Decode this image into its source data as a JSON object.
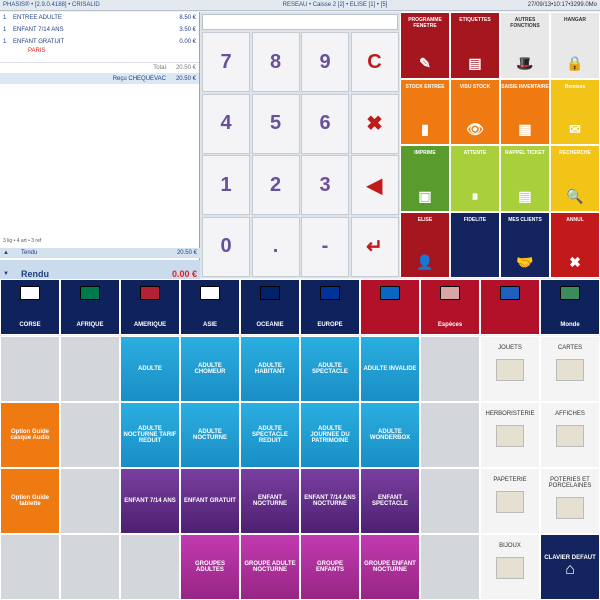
{
  "topbar": {
    "left": "PHASIS® • [2.9.0.4188] • CRISALID",
    "center": "RESEAU  •  Caisse 2 [2] • ELISE [1]  •  [5]",
    "right": "27/09/13•10:17•3299.0Mo"
  },
  "ticket": {
    "lines": [
      {
        "q": "1",
        "n": "ENTREE ADULTE",
        "p": "8.50 €"
      },
      {
        "q": "1",
        "n": "ENFANT 7/14 ANS",
        "p": "3.50 €"
      },
      {
        "q": "1",
        "n": "ENFANT GRATUIT",
        "p": "0.00 €"
      }
    ],
    "sub": "PARIS",
    "total_label": "Total",
    "total": "20.50 €",
    "recu_label": "Reçu CHEQUEVAC",
    "recu": "20.50 €",
    "stats": "3 lig • 4 art • 3 ref",
    "tendu_label": "Tendu",
    "tendu": "20.50 €",
    "rendu_label": "Rendu",
    "rendu": "0.00 €"
  },
  "keypad": [
    "7",
    "8",
    "9",
    "C",
    "4",
    "5",
    "6",
    "✖",
    "1",
    "2",
    "3",
    "◀",
    "0",
    ".",
    "-",
    "↵"
  ],
  "functions": [
    {
      "label": "PROGRAMME FENETRE",
      "color": "#a5161f",
      "icon": "✎"
    },
    {
      "label": "ETIQUETTES",
      "color": "#a5161f",
      "icon": "▤"
    },
    {
      "label": "AUTRES FONCTIONS",
      "color": "#e8e8e8",
      "icon": "🎩",
      "dark": true
    },
    {
      "label": "HANGAR",
      "color": "#e8e8e8",
      "icon": "🔒",
      "dark": true
    },
    {
      "label": "STOCK ENTREE",
      "color": "#f07a12",
      "icon": "▮"
    },
    {
      "label": "VISU STOCK",
      "color": "#f07a12",
      "icon": "👁"
    },
    {
      "label": "SAISIE INVENTAIRE",
      "color": "#f07a12",
      "icon": "▦"
    },
    {
      "label": "Remises",
      "color": "#f1c417",
      "icon": "✉"
    },
    {
      "label": "IMPRIME",
      "color": "#5a9b2e",
      "icon": "▣"
    },
    {
      "label": "ATTENTE",
      "color": "#a9cf3a",
      "icon": "⏸"
    },
    {
      "label": "RAPPEL TICKET",
      "color": "#a9cf3a",
      "icon": "▤"
    },
    {
      "label": "RECHERCHE",
      "color": "#f1c417",
      "icon": "🔍"
    },
    {
      "label": "ELISE",
      "color": "#a5161f",
      "icon": "👤"
    },
    {
      "label": "FIDELITE",
      "color": "#13245e",
      "icon": ""
    },
    {
      "label": "MES CLIENTS",
      "color": "#13245e",
      "icon": "🤝"
    },
    {
      "label": "ANNUL",
      "color": "#c21a1a",
      "icon": "✖"
    }
  ],
  "flags": [
    {
      "label": "CORSE",
      "c": "#fff"
    },
    {
      "label": "AFRIQUE",
      "c": "#007a4d"
    },
    {
      "label": "AMERIQUE",
      "c": "#b22234"
    },
    {
      "label": "ASIE",
      "c": "#fff"
    },
    {
      "label": "OCEANIE",
      "c": "#012169"
    },
    {
      "label": "EUROPE",
      "c": "#003399"
    },
    {
      "label": "",
      "c": "#0a66c2",
      "red": true
    },
    {
      "label": "Espèces",
      "c": "#d9a6a6",
      "red": true
    },
    {
      "label": "",
      "c": "#1f5fbf",
      "red": true
    },
    {
      "label": "Monde",
      "c": "#3a8c5a"
    }
  ],
  "tiles": [
    {
      "t": "",
      "k": "empty"
    },
    {
      "t": "",
      "k": "empty"
    },
    {
      "t": "ADULTE",
      "k": "blue"
    },
    {
      "t": "ADULTE CHOMEUR",
      "k": "blue"
    },
    {
      "t": "ADULTE HABITANT",
      "k": "blue"
    },
    {
      "t": "ADULTE SPECTACLE",
      "k": "blue"
    },
    {
      "t": "ADULTE INVALIDE",
      "k": "blue"
    },
    {
      "t": "",
      "k": "empty"
    },
    {
      "t": "JOUETS",
      "k": "white"
    },
    {
      "t": "CARTES",
      "k": "white"
    },
    {
      "t": "Option Guide casque Audio",
      "k": "orange"
    },
    {
      "t": "",
      "k": "empty"
    },
    {
      "t": "ADULTE NOCTURNE TARIF REDUIT",
      "k": "blue"
    },
    {
      "t": "ADULTE NOCTURNE",
      "k": "blue"
    },
    {
      "t": "ADULTE SPECTACLE REDUIT",
      "k": "blue"
    },
    {
      "t": "ADULTE JOURNEE DU PATRIMOINE",
      "k": "blue"
    },
    {
      "t": "ADULTE WONDERBOX",
      "k": "blue"
    },
    {
      "t": "",
      "k": "empty"
    },
    {
      "t": "HERBORISTERIE",
      "k": "white"
    },
    {
      "t": "AFFICHES",
      "k": "white"
    },
    {
      "t": "Option Guide tablette",
      "k": "orange"
    },
    {
      "t": "",
      "k": "empty"
    },
    {
      "t": "ENFANT 7/14 ANS",
      "k": "purple"
    },
    {
      "t": "ENFANT GRATUIT",
      "k": "purple"
    },
    {
      "t": "ENFANT NOCTURNE",
      "k": "purple"
    },
    {
      "t": "ENFANT 7/14 ANS NOCTURNE",
      "k": "purple"
    },
    {
      "t": "ENFANT SPECTACLE",
      "k": "purple"
    },
    {
      "t": "",
      "k": "empty"
    },
    {
      "t": "PAPETERIE",
      "k": "white"
    },
    {
      "t": "POTERIES ET PORCELAINES",
      "k": "white"
    },
    {
      "t": "",
      "k": "empty"
    },
    {
      "t": "",
      "k": "empty"
    },
    {
      "t": "",
      "k": "empty"
    },
    {
      "t": "GROUPES ADULTES",
      "k": "magenta"
    },
    {
      "t": "GROUPE ADULTE NOCTURNE",
      "k": "magenta"
    },
    {
      "t": "GROUPE ENFANTS",
      "k": "magenta"
    },
    {
      "t": "GROUPE ENFANT NOCTURNE",
      "k": "magenta"
    },
    {
      "t": "",
      "k": "empty"
    },
    {
      "t": "BIJOUX",
      "k": "white"
    },
    {
      "t": "CLAVIER DEFAUT",
      "k": "navy"
    }
  ]
}
